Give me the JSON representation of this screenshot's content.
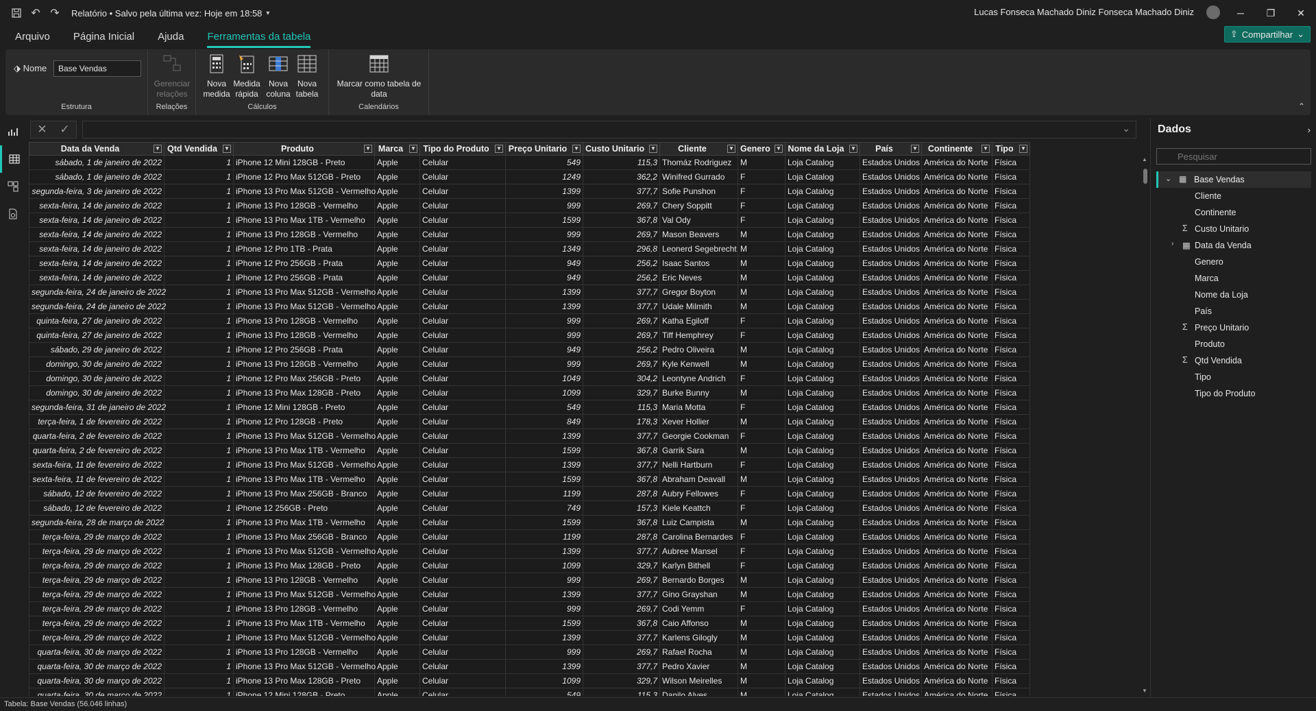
{
  "titlebar": {
    "title": "Relatório • Salvo pela última vez: Hoje em 18:58",
    "user": "Lucas Fonseca Machado Diniz Fonseca Machado Diniz",
    "icons": [
      "save-icon",
      "undo-icon",
      "redo-icon"
    ],
    "window_controls": {
      "minimize": "─",
      "restore": "❐",
      "close": "✕"
    }
  },
  "menu": {
    "tabs": [
      {
        "label": "Arquivo"
      },
      {
        "label": "Página Inicial"
      },
      {
        "label": "Ajuda"
      },
      {
        "label": "Ferramentas da tabela"
      }
    ],
    "share_label": "Compartilhar"
  },
  "ribbon": {
    "name_label": "Nome",
    "name_value": "Base Vendas",
    "groups": {
      "estrutura": "Estrutura",
      "relacoes": "Relações",
      "calculos": "Cálculos",
      "calendarios": "Calendários"
    },
    "buttons": {
      "gerenciar": "Gerenciar relações",
      "nova_medida": "Nova medida",
      "medida_rapida": "Medida rápida",
      "nova_coluna": "Nova coluna",
      "nova_tabela": "Nova tabela",
      "marcar": "Marcar como tabela de data"
    }
  },
  "grid": {
    "columns": [
      "Data da Venda",
      "Qtd Vendida",
      "Produto",
      "Marca",
      "Tipo do Produto",
      "Preço Unitario",
      "Custo Unitario",
      "Cliente",
      "Genero",
      "Nome da Loja",
      "País",
      "Continente",
      "Tipo"
    ],
    "rows": [
      [
        "sábado, 1 de janeiro de 2022",
        "1",
        "iPhone 12 Mini 128GB - Preto",
        "Apple",
        "Celular",
        "549",
        "115,3",
        "Thomáz Rodriguez",
        "M",
        "Loja Catalog",
        "Estados Unidos",
        "América do Norte",
        "Física"
      ],
      [
        "sábado, 1 de janeiro de 2022",
        "1",
        "iPhone 12 Pro Max 512GB - Preto",
        "Apple",
        "Celular",
        "1249",
        "362,2",
        "Winifred Gurrado",
        "F",
        "Loja Catalog",
        "Estados Unidos",
        "América do Norte",
        "Física"
      ],
      [
        "segunda-feira, 3 de janeiro de 2022",
        "1",
        "iPhone 13 Pro Max 512GB - Vermelho",
        "Apple",
        "Celular",
        "1399",
        "377,7",
        "Sofie Punshon",
        "F",
        "Loja Catalog",
        "Estados Unidos",
        "América do Norte",
        "Física"
      ],
      [
        "sexta-feira, 14 de janeiro de 2022",
        "1",
        "iPhone 13 Pro 128GB - Vermelho",
        "Apple",
        "Celular",
        "999",
        "269,7",
        "Chery Soppitt",
        "F",
        "Loja Catalog",
        "Estados Unidos",
        "América do Norte",
        "Física"
      ],
      [
        "sexta-feira, 14 de janeiro de 2022",
        "1",
        "iPhone 13 Pro Max 1TB - Vermelho",
        "Apple",
        "Celular",
        "1599",
        "367,8",
        "Val Ody",
        "F",
        "Loja Catalog",
        "Estados Unidos",
        "América do Norte",
        "Física"
      ],
      [
        "sexta-feira, 14 de janeiro de 2022",
        "1",
        "iPhone 13 Pro 128GB - Vermelho",
        "Apple",
        "Celular",
        "999",
        "269,7",
        "Mason Beavers",
        "M",
        "Loja Catalog",
        "Estados Unidos",
        "América do Norte",
        "Física"
      ],
      [
        "sexta-feira, 14 de janeiro de 2022",
        "1",
        "iPhone 12 Pro 1TB - Prata",
        "Apple",
        "Celular",
        "1349",
        "296,8",
        "Leonerd Segebrecht",
        "M",
        "Loja Catalog",
        "Estados Unidos",
        "América do Norte",
        "Física"
      ],
      [
        "sexta-feira, 14 de janeiro de 2022",
        "1",
        "iPhone 12 Pro 256GB - Prata",
        "Apple",
        "Celular",
        "949",
        "256,2",
        "Isaac Santos",
        "M",
        "Loja Catalog",
        "Estados Unidos",
        "América do Norte",
        "Física"
      ],
      [
        "sexta-feira, 14 de janeiro de 2022",
        "1",
        "iPhone 12 Pro 256GB - Prata",
        "Apple",
        "Celular",
        "949",
        "256,2",
        "Eric Neves",
        "M",
        "Loja Catalog",
        "Estados Unidos",
        "América do Norte",
        "Física"
      ],
      [
        "segunda-feira, 24 de janeiro de 2022",
        "1",
        "iPhone 13 Pro Max 512GB - Vermelho",
        "Apple",
        "Celular",
        "1399",
        "377,7",
        "Gregor Boyton",
        "M",
        "Loja Catalog",
        "Estados Unidos",
        "América do Norte",
        "Física"
      ],
      [
        "segunda-feira, 24 de janeiro de 2022",
        "1",
        "iPhone 13 Pro Max 512GB - Vermelho",
        "Apple",
        "Celular",
        "1399",
        "377,7",
        "Udale Milmith",
        "M",
        "Loja Catalog",
        "Estados Unidos",
        "América do Norte",
        "Física"
      ],
      [
        "quinta-feira, 27 de janeiro de 2022",
        "1",
        "iPhone 13 Pro 128GB - Vermelho",
        "Apple",
        "Celular",
        "999",
        "269,7",
        "Katha Egiloff",
        "F",
        "Loja Catalog",
        "Estados Unidos",
        "América do Norte",
        "Física"
      ],
      [
        "quinta-feira, 27 de janeiro de 2022",
        "1",
        "iPhone 13 Pro 128GB - Vermelho",
        "Apple",
        "Celular",
        "999",
        "269,7",
        "Tiff Hemphrey",
        "F",
        "Loja Catalog",
        "Estados Unidos",
        "América do Norte",
        "Física"
      ],
      [
        "sábado, 29 de janeiro de 2022",
        "1",
        "iPhone 12 Pro 256GB - Prata",
        "Apple",
        "Celular",
        "949",
        "256,2",
        "Pedro Oliveira",
        "M",
        "Loja Catalog",
        "Estados Unidos",
        "América do Norte",
        "Física"
      ],
      [
        "domingo, 30 de janeiro de 2022",
        "1",
        "iPhone 13 Pro 128GB - Vermelho",
        "Apple",
        "Celular",
        "999",
        "269,7",
        "Kyle Kenwell",
        "M",
        "Loja Catalog",
        "Estados Unidos",
        "América do Norte",
        "Física"
      ],
      [
        "domingo, 30 de janeiro de 2022",
        "1",
        "iPhone 12 Pro Max 256GB - Preto",
        "Apple",
        "Celular",
        "1049",
        "304,2",
        "Leontyne Andrich",
        "F",
        "Loja Catalog",
        "Estados Unidos",
        "América do Norte",
        "Física"
      ],
      [
        "domingo, 30 de janeiro de 2022",
        "1",
        "iPhone 13 Pro Max 128GB - Preto",
        "Apple",
        "Celular",
        "1099",
        "329,7",
        "Burke Bunny",
        "M",
        "Loja Catalog",
        "Estados Unidos",
        "América do Norte",
        "Física"
      ],
      [
        "segunda-feira, 31 de janeiro de 2022",
        "1",
        "iPhone 12 Mini 128GB - Preto",
        "Apple",
        "Celular",
        "549",
        "115,3",
        "Maria Motta",
        "F",
        "Loja Catalog",
        "Estados Unidos",
        "América do Norte",
        "Física"
      ],
      [
        "terça-feira, 1 de fevereiro de 2022",
        "1",
        "iPhone 12 Pro 128GB - Preto",
        "Apple",
        "Celular",
        "849",
        "178,3",
        "Xever Hollier",
        "M",
        "Loja Catalog",
        "Estados Unidos",
        "América do Norte",
        "Física"
      ],
      [
        "quarta-feira, 2 de fevereiro de 2022",
        "1",
        "iPhone 13 Pro Max 512GB - Vermelho",
        "Apple",
        "Celular",
        "1399",
        "377,7",
        "Georgie Cookman",
        "F",
        "Loja Catalog",
        "Estados Unidos",
        "América do Norte",
        "Física"
      ],
      [
        "quarta-feira, 2 de fevereiro de 2022",
        "1",
        "iPhone 13 Pro Max 1TB - Vermelho",
        "Apple",
        "Celular",
        "1599",
        "367,8",
        "Garrik Sara",
        "M",
        "Loja Catalog",
        "Estados Unidos",
        "América do Norte",
        "Física"
      ],
      [
        "sexta-feira, 11 de fevereiro de 2022",
        "1",
        "iPhone 13 Pro Max 512GB - Vermelho",
        "Apple",
        "Celular",
        "1399",
        "377,7",
        "Nelli Hartburn",
        "F",
        "Loja Catalog",
        "Estados Unidos",
        "América do Norte",
        "Física"
      ],
      [
        "sexta-feira, 11 de fevereiro de 2022",
        "1",
        "iPhone 13 Pro Max 1TB - Vermelho",
        "Apple",
        "Celular",
        "1599",
        "367,8",
        "Abraham Deavall",
        "M",
        "Loja Catalog",
        "Estados Unidos",
        "América do Norte",
        "Física"
      ],
      [
        "sábado, 12 de fevereiro de 2022",
        "1",
        "iPhone 13 Pro Max 256GB - Branco",
        "Apple",
        "Celular",
        "1199",
        "287,8",
        "Aubry Fellowes",
        "F",
        "Loja Catalog",
        "Estados Unidos",
        "América do Norte",
        "Física"
      ],
      [
        "sábado, 12 de fevereiro de 2022",
        "1",
        "iPhone 12 256GB - Preto",
        "Apple",
        "Celular",
        "749",
        "157,3",
        "Kiele Keattch",
        "F",
        "Loja Catalog",
        "Estados Unidos",
        "América do Norte",
        "Física"
      ],
      [
        "segunda-feira, 28 de março de 2022",
        "1",
        "iPhone 13 Pro Max 1TB - Vermelho",
        "Apple",
        "Celular",
        "1599",
        "367,8",
        "Luiz Campista",
        "M",
        "Loja Catalog",
        "Estados Unidos",
        "América do Norte",
        "Física"
      ],
      [
        "terça-feira, 29 de março de 2022",
        "1",
        "iPhone 13 Pro Max 256GB - Branco",
        "Apple",
        "Celular",
        "1199",
        "287,8",
        "Carolina Bernardes",
        "F",
        "Loja Catalog",
        "Estados Unidos",
        "América do Norte",
        "Física"
      ],
      [
        "terça-feira, 29 de março de 2022",
        "1",
        "iPhone 13 Pro Max 512GB - Vermelho",
        "Apple",
        "Celular",
        "1399",
        "377,7",
        "Aubree Mansel",
        "F",
        "Loja Catalog",
        "Estados Unidos",
        "América do Norte",
        "Física"
      ],
      [
        "terça-feira, 29 de março de 2022",
        "1",
        "iPhone 13 Pro Max 128GB - Preto",
        "Apple",
        "Celular",
        "1099",
        "329,7",
        "Karlyn Bithell",
        "F",
        "Loja Catalog",
        "Estados Unidos",
        "América do Norte",
        "Física"
      ],
      [
        "terça-feira, 29 de março de 2022",
        "1",
        "iPhone 13 Pro 128GB - Vermelho",
        "Apple",
        "Celular",
        "999",
        "269,7",
        "Bernardo Borges",
        "M",
        "Loja Catalog",
        "Estados Unidos",
        "América do Norte",
        "Física"
      ],
      [
        "terça-feira, 29 de março de 2022",
        "1",
        "iPhone 13 Pro Max 512GB - Vermelho",
        "Apple",
        "Celular",
        "1399",
        "377,7",
        "Gino Grayshan",
        "M",
        "Loja Catalog",
        "Estados Unidos",
        "América do Norte",
        "Física"
      ],
      [
        "terça-feira, 29 de março de 2022",
        "1",
        "iPhone 13 Pro 128GB - Vermelho",
        "Apple",
        "Celular",
        "999",
        "269,7",
        "Codi Yemm",
        "F",
        "Loja Catalog",
        "Estados Unidos",
        "América do Norte",
        "Física"
      ],
      [
        "terça-feira, 29 de março de 2022",
        "1",
        "iPhone 13 Pro Max 1TB - Vermelho",
        "Apple",
        "Celular",
        "1599",
        "367,8",
        "Caio Affonso",
        "M",
        "Loja Catalog",
        "Estados Unidos",
        "América do Norte",
        "Física"
      ],
      [
        "terça-feira, 29 de março de 2022",
        "1",
        "iPhone 13 Pro Max 512GB - Vermelho",
        "Apple",
        "Celular",
        "1399",
        "377,7",
        "Karlens Gilogly",
        "M",
        "Loja Catalog",
        "Estados Unidos",
        "América do Norte",
        "Física"
      ],
      [
        "quarta-feira, 30 de março de 2022",
        "1",
        "iPhone 13 Pro 128GB - Vermelho",
        "Apple",
        "Celular",
        "999",
        "269,7",
        "Rafael Rocha",
        "M",
        "Loja Catalog",
        "Estados Unidos",
        "América do Norte",
        "Física"
      ],
      [
        "quarta-feira, 30 de março de 2022",
        "1",
        "iPhone 13 Pro Max 512GB - Vermelho",
        "Apple",
        "Celular",
        "1399",
        "377,7",
        "Pedro Xavier",
        "M",
        "Loja Catalog",
        "Estados Unidos",
        "América do Norte",
        "Física"
      ],
      [
        "quarta-feira, 30 de março de 2022",
        "1",
        "iPhone 13 Pro Max 128GB - Preto",
        "Apple",
        "Celular",
        "1099",
        "329,7",
        "Wilson Meirelles",
        "M",
        "Loja Catalog",
        "Estados Unidos",
        "América do Norte",
        "Física"
      ],
      [
        "quarta-feira, 30 de março de 2022",
        "1",
        "iPhone 12 Mini 128GB - Preto",
        "Apple",
        "Celular",
        "549",
        "115,3",
        "Danilo Alves",
        "M",
        "Loja Catalog",
        "Estados Unidos",
        "América do Norte",
        "Física"
      ]
    ]
  },
  "datapane": {
    "title": "Dados",
    "search_placeholder": "Pesquisar",
    "table_name": "Base Vendas",
    "fields": [
      {
        "label": "Cliente",
        "kind": "text"
      },
      {
        "label": "Continente",
        "kind": "text"
      },
      {
        "label": "Custo Unitario",
        "kind": "sum"
      },
      {
        "label": "Data da Venda",
        "kind": "hierarchy"
      },
      {
        "label": "Genero",
        "kind": "text"
      },
      {
        "label": "Marca",
        "kind": "text"
      },
      {
        "label": "Nome da Loja",
        "kind": "text"
      },
      {
        "label": "País",
        "kind": "text"
      },
      {
        "label": "Preço Unitario",
        "kind": "sum"
      },
      {
        "label": "Produto",
        "kind": "text"
      },
      {
        "label": "Qtd Vendida",
        "kind": "sum"
      },
      {
        "label": "Tipo",
        "kind": "text"
      },
      {
        "label": "Tipo do Produto",
        "kind": "text"
      }
    ]
  },
  "status": {
    "text": "Tabela: Base Vendas (56.046 linhas)"
  },
  "colors": {
    "accent": "#21c7b9",
    "background": "#1f1f1f",
    "ribbon": "#2b2b2b",
    "share": "#0e6b5e"
  }
}
